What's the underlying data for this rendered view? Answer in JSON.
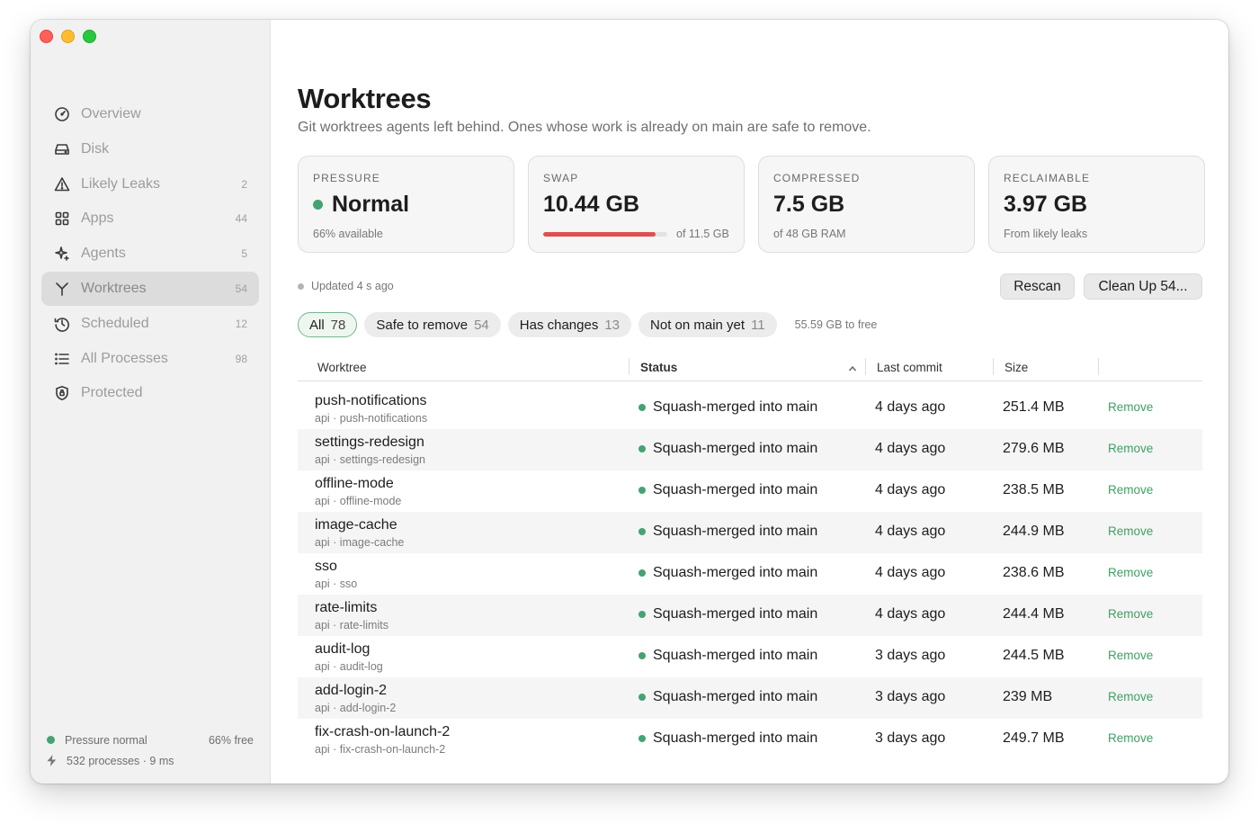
{
  "sidebar": {
    "items": [
      {
        "label": "Overview",
        "count": "",
        "icon": "gauge-icon"
      },
      {
        "label": "Disk",
        "count": "",
        "icon": "disk-icon"
      },
      {
        "label": "Likely Leaks",
        "count": "2",
        "icon": "warning-icon"
      },
      {
        "label": "Apps",
        "count": "44",
        "icon": "grid-icon"
      },
      {
        "label": "Agents",
        "count": "5",
        "icon": "sparkle-icon"
      },
      {
        "label": "Worktrees",
        "count": "54",
        "icon": "branch-icon",
        "active": true
      },
      {
        "label": "Scheduled",
        "count": "12",
        "icon": "clock-icon"
      },
      {
        "label": "All Processes",
        "count": "98",
        "icon": "list-icon"
      },
      {
        "label": "Protected",
        "count": "",
        "icon": "shield-icon"
      }
    ],
    "footer": {
      "pressure": "Pressure normal",
      "free": "66% free",
      "processes": "532 processes · 9 ms"
    }
  },
  "main": {
    "title": "Worktrees",
    "subtitle": "Git worktrees agents left behind. Ones whose work is already on main are safe to remove.",
    "cards": {
      "pressure": {
        "label": "PRESSURE",
        "value": "Normal",
        "foot": "66% available"
      },
      "swap": {
        "label": "SWAP",
        "value": "10.44 GB",
        "foot": "of 11.5 GB",
        "used_fraction": 0.908
      },
      "compressed": {
        "label": "COMPRESSED",
        "value": "7.5 GB",
        "foot": "of 48 GB RAM"
      },
      "reclaimable": {
        "label": "RECLAIMABLE",
        "value": "3.97 GB",
        "foot": "From likely leaks"
      }
    },
    "updated": "Updated 4 s ago",
    "buttons": {
      "rescan": "Rescan",
      "cleanup": "Clean Up 54..."
    },
    "filters": [
      {
        "label": "All",
        "count": "78",
        "active": true
      },
      {
        "label": "Safe to remove",
        "count": "54"
      },
      {
        "label": "Has changes",
        "count": "13"
      },
      {
        "label": "Not on main yet",
        "count": "11"
      }
    ],
    "free_note": "55.59 GB to free",
    "table": {
      "headers": {
        "worktree": "Worktree",
        "status": "Status",
        "last_commit": "Last commit",
        "size": "Size"
      },
      "rows": [
        {
          "name": "push-notifications",
          "path": "api · push-notifications",
          "status": "Squash-merged into main",
          "commit": "4 days ago",
          "size": "251.4 MB",
          "action": "Remove"
        },
        {
          "name": "settings-redesign",
          "path": "api · settings-redesign",
          "status": "Squash-merged into main",
          "commit": "4 days ago",
          "size": "279.6 MB",
          "action": "Remove"
        },
        {
          "name": "offline-mode",
          "path": "api · offline-mode",
          "status": "Squash-merged into main",
          "commit": "4 days ago",
          "size": "238.5 MB",
          "action": "Remove"
        },
        {
          "name": "image-cache",
          "path": "api · image-cache",
          "status": "Squash-merged into main",
          "commit": "4 days ago",
          "size": "244.9 MB",
          "action": "Remove"
        },
        {
          "name": "sso",
          "path": "api · sso",
          "status": "Squash-merged into main",
          "commit": "4 days ago",
          "size": "238.6 MB",
          "action": "Remove"
        },
        {
          "name": "rate-limits",
          "path": "api · rate-limits",
          "status": "Squash-merged into main",
          "commit": "4 days ago",
          "size": "244.4 MB",
          "action": "Remove"
        },
        {
          "name": "audit-log",
          "path": "api · audit-log",
          "status": "Squash-merged into main",
          "commit": "3 days ago",
          "size": "244.5 MB",
          "action": "Remove"
        },
        {
          "name": "add-login-2",
          "path": "api · add-login-2",
          "status": "Squash-merged into main",
          "commit": "3 days ago",
          "size": "239 MB",
          "action": "Remove"
        },
        {
          "name": "fix-crash-on-launch-2",
          "path": "api · fix-crash-on-launch-2",
          "status": "Squash-merged into main",
          "commit": "3 days ago",
          "size": "249.7 MB",
          "action": "Remove"
        }
      ]
    }
  },
  "colors": {
    "accent_green": "#45a371",
    "swap_red": "#e04f4f",
    "link_green": "#3f9f63"
  }
}
